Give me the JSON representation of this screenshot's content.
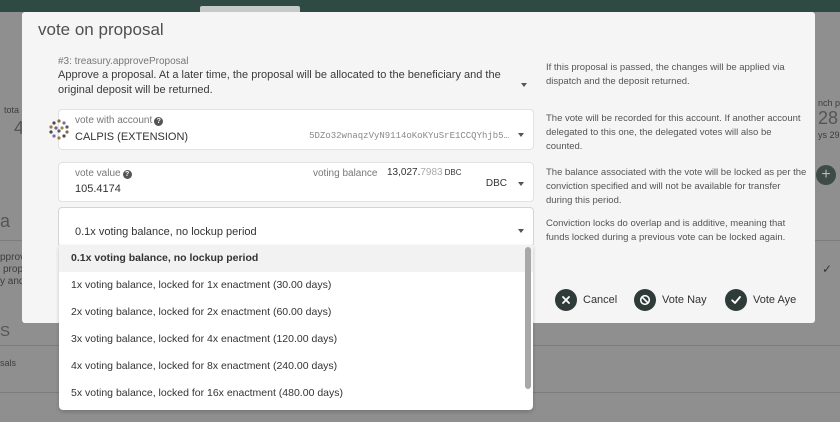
{
  "background": {
    "text_left_1": "tota",
    "text_left_2": "4",
    "text_left_3": "a",
    "text_left_4": "pprov",
    "text_left_5": "prop",
    "text_left_6": "y and",
    "text_left_7": "S",
    "text_left_8": "sals",
    "text_right_1": "nch p",
    "text_right_2": "28 d",
    "text_right_3": "ys 29"
  },
  "modal": {
    "title": "vote on proposal",
    "proposal": {
      "label": "#3: treasury.approveProposal",
      "text": "Approve a proposal. At a later time, the proposal will be allocated to the beneficiary and the original deposit will be returned.",
      "help": "If this proposal is passed, the changes will be applied via dispatch and the deposit returned."
    },
    "account": {
      "label": "vote with account",
      "name": "CALPIS (EXTENSION)",
      "address": "5DZo32wnaqzVyN9114oKoKYuSrE1CCQYhjb5…",
      "help": "The vote will be recorded for this account. If another account delegated to this one, the delegated votes will also be counted."
    },
    "value": {
      "label": "vote value",
      "amount": "105.4174",
      "balance_label": "voting balance",
      "balance_int": "13,027.",
      "balance_frac": "7983",
      "balance_unit": "DBC",
      "unit": "DBC",
      "help": "The balance associated with the vote will be locked as per the conviction specified and will not be available for transfer during this period."
    },
    "conviction": {
      "selected": "0.1x voting balance, no lockup period",
      "help": "Conviction locks do overlap and is additive, meaning that funds locked during a previous vote can be locked again.",
      "options": [
        "0.1x voting balance, no lockup period",
        "1x voting balance, locked for 1x enactment (30.00 days)",
        "2x voting balance, locked for 2x enactment (60.00 days)",
        "3x voting balance, locked for 4x enactment (120.00 days)",
        "4x voting balance, locked for 8x enactment (240.00 days)",
        "5x voting balance, locked for 16x enactment (480.00 days)"
      ]
    },
    "buttons": {
      "cancel": "Cancel",
      "nay": "Vote Nay",
      "aye": "Vote Aye"
    }
  },
  "colors": {
    "button_icon": "#2f3b38",
    "topbar": "#2f4a43"
  },
  "icons": {
    "cancel": "close-icon",
    "nay": "ban-icon",
    "aye": "check-icon",
    "help": "question-icon",
    "dropdown": "caret-down-icon"
  }
}
